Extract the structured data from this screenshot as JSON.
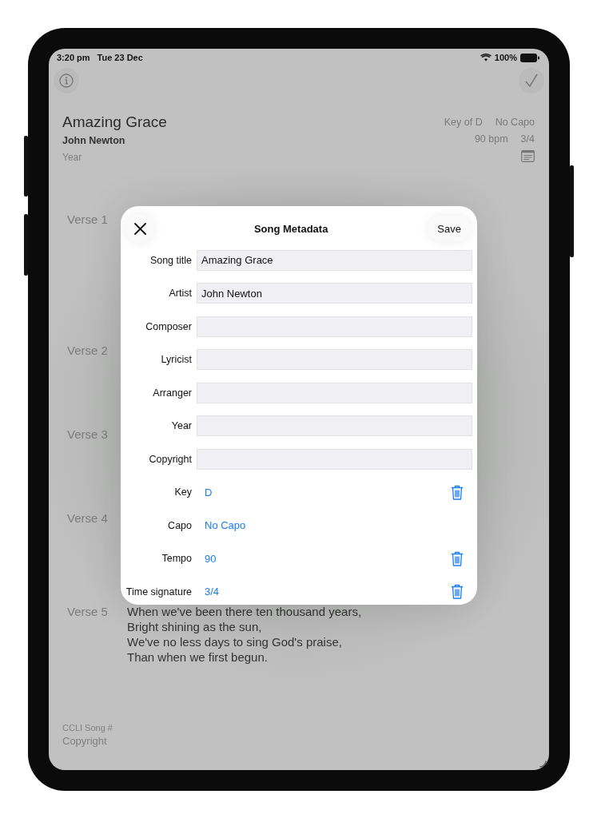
{
  "status_bar": {
    "time": "3:20 pm",
    "date": "Tue 23 Dec",
    "battery": "100%"
  },
  "song": {
    "title": "Amazing Grace",
    "artist": "John Newton",
    "year": "Year",
    "key": "Key of D",
    "capo": "No Capo",
    "tempo": "90 bpm",
    "time_signature": "3/4"
  },
  "sections": [
    {
      "label": "Verse 1"
    },
    {
      "label": "Verse 2"
    },
    {
      "label": "Verse 3"
    },
    {
      "label": "Verse 4"
    },
    {
      "label": "Verse 5",
      "lines": [
        "When we've been there ten thousand years,",
        "Bright shining as the sun,",
        "We've no less days to sing God's praise,",
        "Than when we first begun."
      ]
    }
  ],
  "footer": {
    "ccli": "CCLI Song #",
    "copyright": "Copyright"
  },
  "dialog": {
    "title": "Song Metadata",
    "save": "Save",
    "fields": [
      {
        "kind": "text",
        "label": "Song title",
        "value": "Amazing Grace"
      },
      {
        "kind": "text",
        "label": "Artist",
        "value": "John Newton"
      },
      {
        "kind": "text",
        "label": "Composer"
      },
      {
        "kind": "text",
        "label": "Lyricist"
      },
      {
        "kind": "text",
        "label": "Arranger"
      },
      {
        "kind": "text",
        "label": "Year"
      },
      {
        "kind": "text",
        "label": "Copyright"
      },
      {
        "kind": "choice",
        "label": "Key",
        "value": "D",
        "deletable": true
      },
      {
        "kind": "choice",
        "label": "Capo",
        "value": "No Capo",
        "deletable": false
      },
      {
        "kind": "choice",
        "label": "Tempo",
        "value": "90",
        "deletable": true
      },
      {
        "kind": "choice",
        "label": "Time signature",
        "value": "3/4",
        "deletable": true
      }
    ]
  }
}
